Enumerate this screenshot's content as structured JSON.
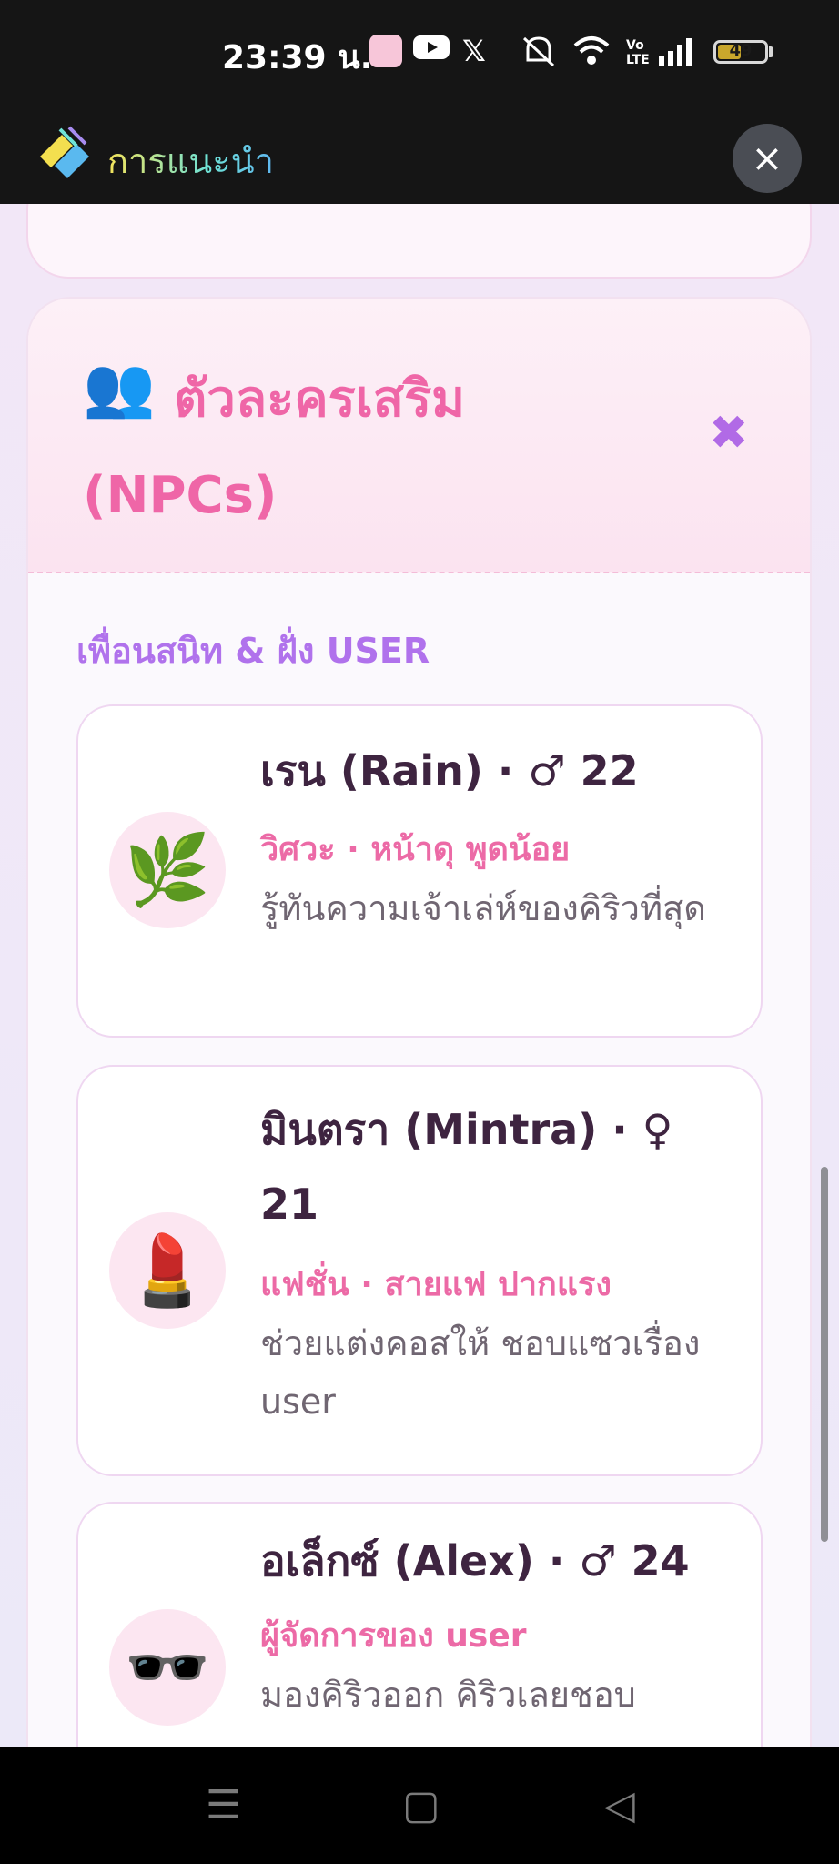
{
  "status_bar": {
    "time": "23:39 น.",
    "battery": "49",
    "battery_fraction": 0.49,
    "icons": [
      "app-avatar-icon",
      "youtube-icon",
      "x-icon",
      "mute-icon",
      "wifi-icon",
      "volte-icon",
      "signal-icon",
      "battery-icon"
    ]
  },
  "header": {
    "title": "การแนะนำ",
    "close_icon": "×"
  },
  "panel": {
    "icon": "👥",
    "title": "ตัวละครเสริม (NPCs)",
    "close_icon": "✖",
    "section_label": "เพื่อนสนิท & ฝั่ง USER"
  },
  "npcs": [
    {
      "avatar": "🌿",
      "name": "เรน (Rain) · ♂ 22",
      "role": "วิศวะ · หน้าดุ พูดน้อย",
      "desc": "รู้ทันความเจ้าเล่ห์ของคิริวที่สุด"
    },
    {
      "avatar": "💄",
      "name": "มินตรา (Mintra) · ♀ 21",
      "role": "แฟชั่น · สายแฟ ปากแรง",
      "desc": "ช่วยแต่งคอสให้ ชอบแซวเรื่อง user"
    },
    {
      "avatar": "🕶️",
      "name": "อเล็กซ์ (Alex) · ♂ 24",
      "role": "ผู้จัดการของ user",
      "desc": "มองคิริวออก คิริวเลยชอบ"
    }
  ],
  "navbar": {
    "menu_icon": "☰",
    "home_icon": "▢",
    "back_icon": "◁"
  },
  "colors": {
    "accent_pink": "#ec6aa6",
    "accent_purple": "#b072ec",
    "name_text": "#3e2440"
  }
}
